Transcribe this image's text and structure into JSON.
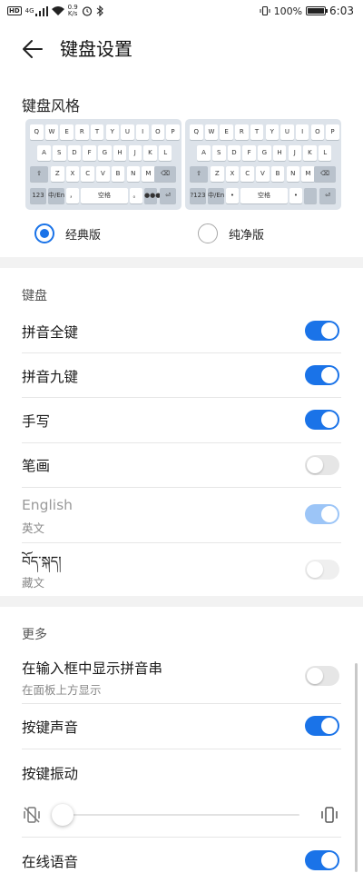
{
  "status_bar": {
    "hd": "HD",
    "network": "4G",
    "speed_value": "0.9",
    "speed_unit": "K/s",
    "battery": "100%",
    "time": "6:03"
  },
  "header": {
    "title": "键盘设置"
  },
  "keyboard_style": {
    "title": "键盘风格",
    "options": [
      {
        "label": "经典版",
        "selected": true
      },
      {
        "label": "纯净版",
        "selected": false
      }
    ],
    "preview": {
      "row1": [
        "Q",
        "W",
        "E",
        "R",
        "T",
        "Y",
        "U",
        "I",
        "O",
        "P"
      ],
      "row2": [
        "A",
        "S",
        "D",
        "F",
        "G",
        "H",
        "J",
        "K",
        "L"
      ],
      "row3": [
        "Z",
        "X",
        "C",
        "V",
        "B",
        "N",
        "M"
      ],
      "bottom_left": "123",
      "bottom_left_alt": "?123",
      "lang_key": "中/En",
      "space": "空格",
      "comma": "，",
      "period": "。",
      "dot": "•",
      "enter_dots": "●●●"
    }
  },
  "keyboard_section": {
    "title": "键盘",
    "items": [
      {
        "label": "拼音全键",
        "toggle": true
      },
      {
        "label": "拼音九键",
        "toggle": true
      },
      {
        "label": "手写",
        "toggle": true
      },
      {
        "label": "笔画",
        "toggle": false
      },
      {
        "label": "English",
        "sub": "英文",
        "toggle": true,
        "disabled": true
      },
      {
        "label": "བོད་སྐད།",
        "sub": "藏文",
        "toggle": false,
        "disabled": true
      }
    ]
  },
  "more_section": {
    "title": "更多",
    "show_pinyin": {
      "label": "在输入框中显示拼音串",
      "sub": "在面板上方显示",
      "toggle": false
    },
    "key_sound": {
      "label": "按键声音",
      "toggle": true
    },
    "key_vibration": {
      "label": "按键振动",
      "level": 0.0
    },
    "online_voice": {
      "label": "在线语音",
      "toggle": true
    }
  },
  "colors": {
    "accent": "#1a73e8",
    "accent_disabled": "#9cc5f7"
  }
}
